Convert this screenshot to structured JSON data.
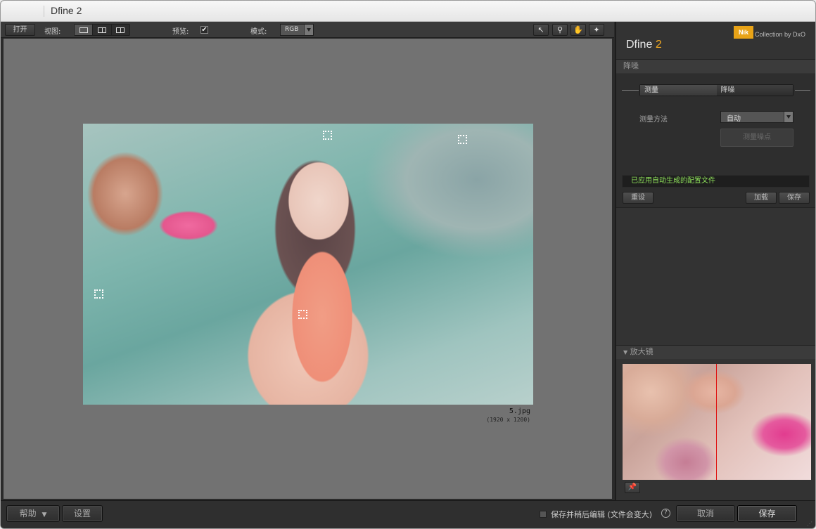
{
  "window": {
    "title": "Dfine 2"
  },
  "toolbar": {
    "open_label": "打开",
    "view_label": "视图:",
    "preview_label": "预览:",
    "preview_checked": "✔",
    "mode_label": "模式:",
    "mode_value": "RGB",
    "tools": [
      "arrow-icon",
      "zoom-icon",
      "hand-icon",
      "bulb-icon"
    ]
  },
  "image": {
    "file_name": "5.jpg",
    "dimensions": "(1920 x 1200)"
  },
  "sidebar": {
    "brand_badge": "Nik",
    "brand_caption": "Collection by DxO",
    "product_name": "Dfine",
    "product_version": "2",
    "section_denoise": "降噪",
    "seg_measure": "测量",
    "seg_reduce": "降噪",
    "method_label": "测量方法",
    "method_value": "自动",
    "measure_points_button": "测量噪点",
    "status_message": "已应用自动生成的配置文件",
    "reset_button": "重设",
    "load_button": "加载",
    "save_button": "保存",
    "loupe_title": "放大镜"
  },
  "bottom": {
    "help_label": "帮助",
    "settings_label": "设置",
    "save_then_edit_label": "保存并稍后编辑 (文件会变大)",
    "cancel_label": "取消",
    "save_label": "保存"
  },
  "colors": {
    "accent": "#f0a821",
    "status_green": "#8ee05a",
    "loupe_marker": "#e01010"
  }
}
